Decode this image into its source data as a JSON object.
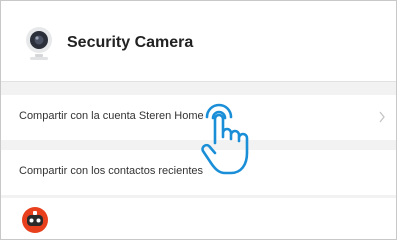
{
  "device": {
    "name": "Security Camera",
    "icon": "security-camera-icon"
  },
  "share_options": [
    {
      "label": "Compartir con la cuenta Steren Home",
      "icon": "chevron-right-icon"
    },
    {
      "label": "Compartir con los contactos recientes"
    }
  ],
  "recent_contacts": [
    {
      "icon": "robot-avatar-icon"
    }
  ],
  "overlay": {
    "icon": "hand-pointer-icon",
    "color": "#1a8fd8"
  },
  "colors": {
    "avatar_accent": "#e8401c",
    "background": "#f2f2f2"
  }
}
